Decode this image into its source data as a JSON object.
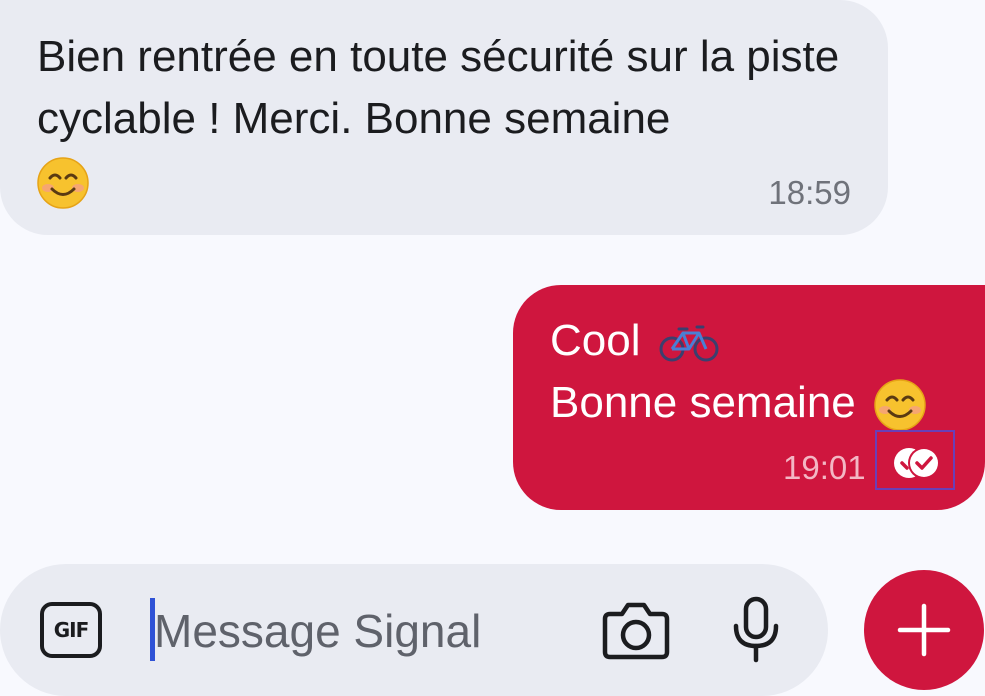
{
  "conversation": {
    "incoming": {
      "text": "Bien rentrée en toute sécurité sur la piste cyclable ! Merci. Bonne semaine",
      "emoji": "smiling-face-icon",
      "time": "18:59"
    },
    "outgoing": {
      "line1": "Cool",
      "line1_emoji": "bicycle-icon",
      "line2": "Bonne semaine",
      "line2_emoji": "smiling-face-icon",
      "time": "19:01",
      "status_icon": "read-receipt-icon"
    }
  },
  "composer": {
    "gif_label": "GIF",
    "placeholder": "Message Signal",
    "value": "",
    "camera_icon": "camera-icon",
    "mic_icon": "microphone-icon",
    "add_icon": "plus-icon"
  },
  "colors": {
    "background": "#f8f9fe",
    "incoming_bubble": "#e9ebf2",
    "outgoing_bubble": "#cf163e",
    "accent": "#cf163e",
    "cursor": "#2f52d6"
  }
}
